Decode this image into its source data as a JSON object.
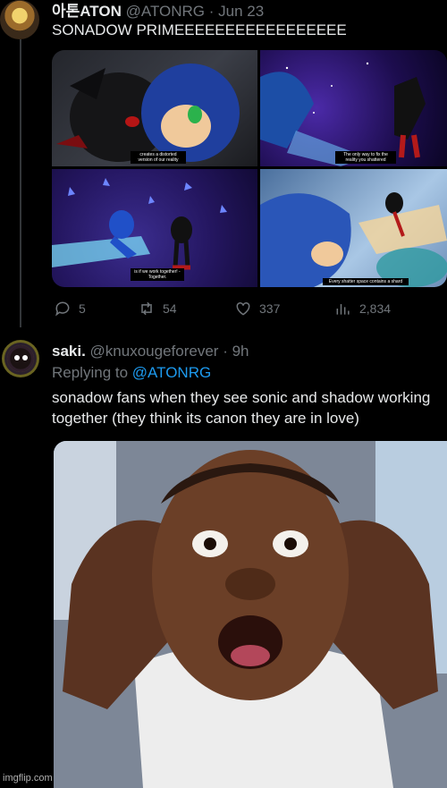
{
  "tweet1": {
    "display_name": "아톤ATON",
    "handle": "@ATONRG",
    "time": "Jun 23",
    "text": "SONADOW PRIMEEEEEEEEEEEEEEEEE",
    "media_captions": [
      "creates a distorted version of our reality",
      "The only way to fix the reality you shattered",
      "is if we work together! - Together.",
      "Every shatter space contains a shard"
    ],
    "stats": {
      "replies": "5",
      "retweets": "54",
      "likes": "337",
      "views": "2,834"
    }
  },
  "tweet2": {
    "display_name": "saki.",
    "handle": "@knuxougeforever",
    "time": "9h",
    "replying_label": "Replying to",
    "replying_handle": "@ATONRG",
    "text": "sonadow fans when they see sonic and shadow working together (they think its canon they are in love)"
  },
  "watermark": "imgflip.com",
  "colors": {
    "background": "#000000",
    "text": "#e7e9ea",
    "muted": "#71767b",
    "link": "#1d9bf0"
  }
}
